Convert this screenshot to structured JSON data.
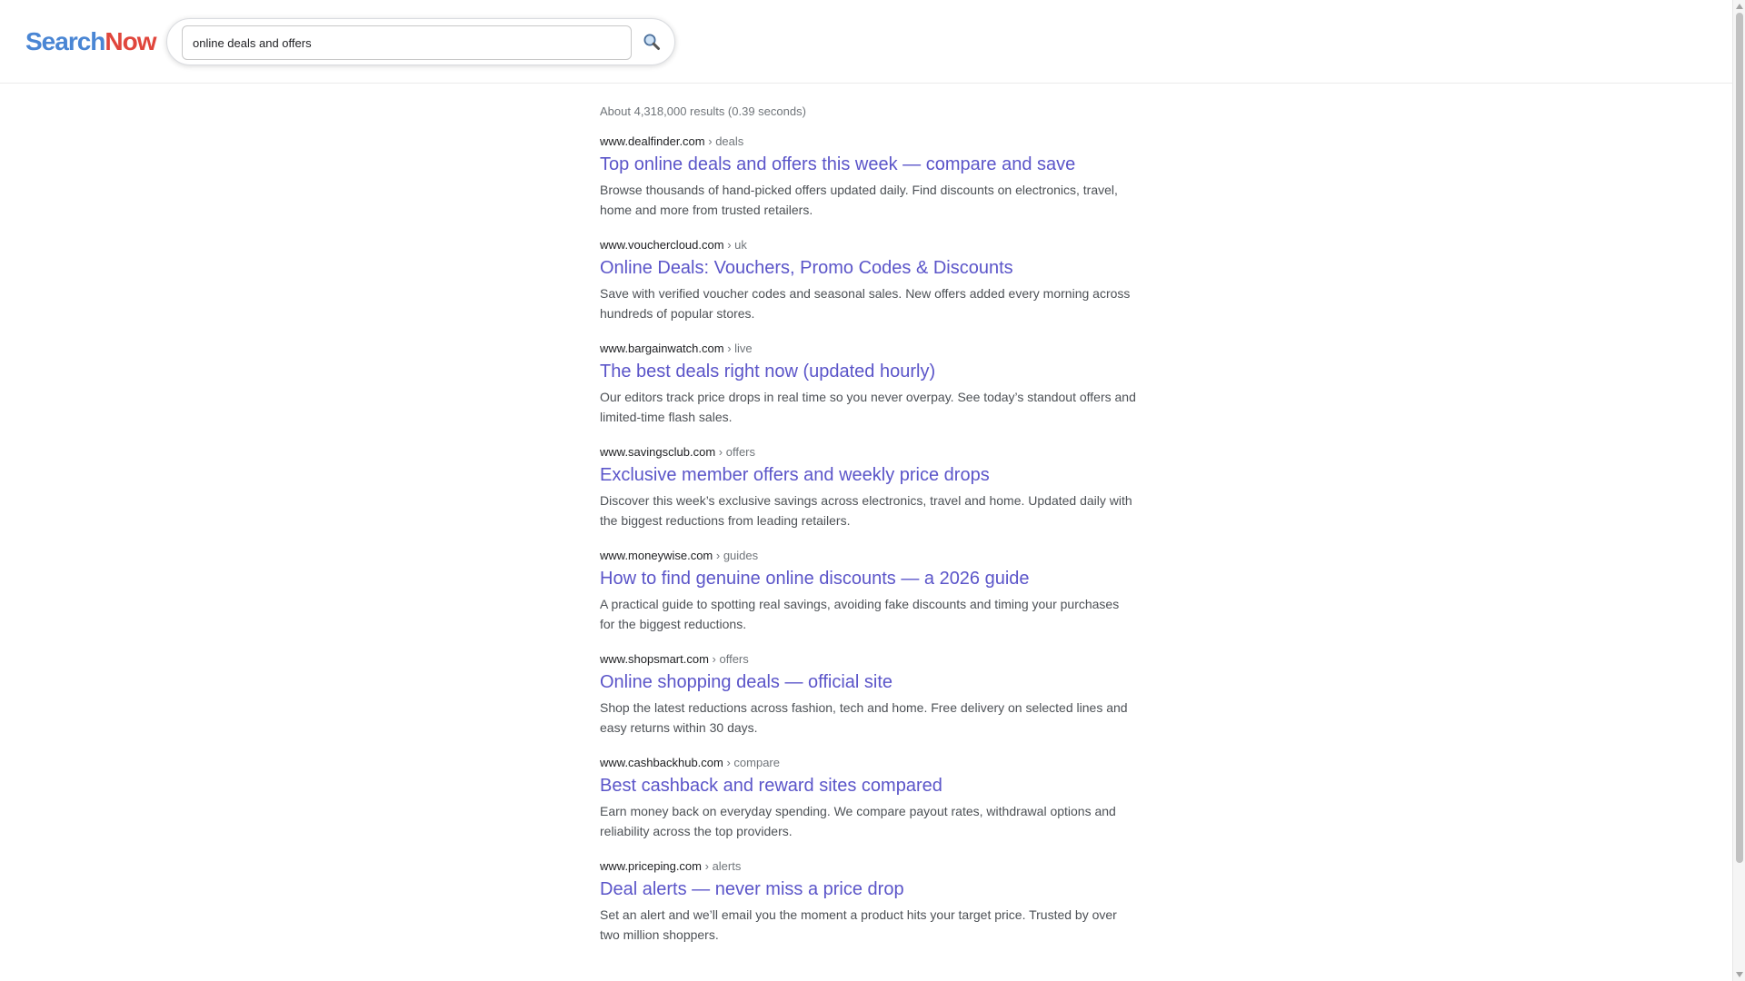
{
  "header": {
    "logo_part1": "Search",
    "logo_part2": "Now",
    "search_value": "online deals and offers",
    "search_icon": "magnifier-icon"
  },
  "stats": "About 4,318,000 results (0.39 seconds)",
  "results": [
    {
      "domain": "www.dealfinder.com",
      "crumb": "› deals",
      "title": "Top online deals and offers this week — compare and save",
      "snippet": "Browse thousands of hand-picked offers updated daily. Find discounts on electronics, travel, home and more from trusted retailers."
    },
    {
      "domain": "www.vouchercloud.com",
      "crumb": "› uk",
      "title": "Online Deals: Vouchers, Promo Codes & Discounts",
      "snippet": "Save with verified voucher codes and seasonal sales. New offers added every morning across hundreds of popular stores."
    },
    {
      "domain": "www.bargainwatch.com",
      "crumb": "› live",
      "title": "The best deals right now (updated hourly)",
      "snippet": "Our editors track price drops in real time so you never overpay. See today’s standout offers and limited-time flash sales."
    },
    {
      "domain": "www.savingsclub.com",
      "crumb": "› offers",
      "title": "Exclusive member offers and weekly price drops",
      "snippet": "Discover this week’s exclusive savings across electronics, travel and home. Updated daily with the biggest reductions from leading retailers."
    },
    {
      "domain": "www.moneywise.com",
      "crumb": "› guides",
      "title": "How to find genuine online discounts — a 2026 guide",
      "snippet": "A practical guide to spotting real savings, avoiding fake discounts and timing your purchases for the biggest reductions."
    },
    {
      "domain": "www.shopsmart.com",
      "crumb": "› offers",
      "title": "Online shopping deals — official site",
      "snippet": "Shop the latest reductions across fashion, tech and home. Free delivery on selected lines and easy returns within 30 days."
    },
    {
      "domain": "www.cashbackhub.com",
      "crumb": "› compare",
      "title": "Best cashback and reward sites compared",
      "snippet": "Earn money back on everyday spending. We compare payout rates, withdrawal options and reliability across the top providers."
    },
    {
      "domain": "www.priceping.com",
      "crumb": "› alerts",
      "title": "Deal alerts — never miss a price drop",
      "snippet": "Set an alert and we’ll email you the moment a product hits your target price. Trusted by over two million shoppers."
    }
  ],
  "colors": {
    "logo_blue": "#4a86d4",
    "logo_red": "#e0463c",
    "link": "#5b55c9"
  }
}
